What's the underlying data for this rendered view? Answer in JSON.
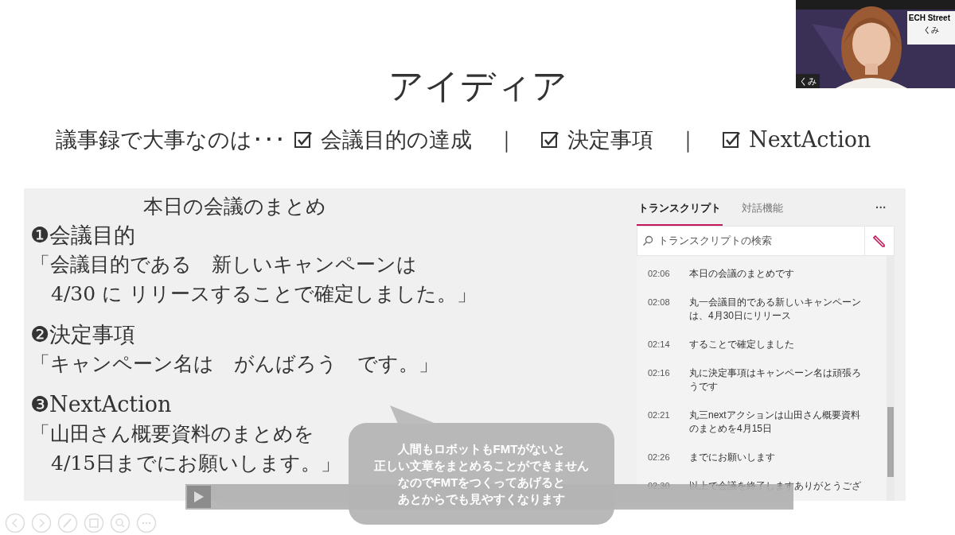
{
  "slide": {
    "title": "アイディア",
    "subtitle": {
      "lead": "議事録で大事なのは･･･",
      "separator": "｜",
      "checks": [
        {
          "label": "会議目的の達成",
          "checked": true
        },
        {
          "label": "決定事項",
          "checked": true
        },
        {
          "label": "NextAction",
          "checked": true
        }
      ]
    }
  },
  "summary": {
    "heading": "本日の会議のまとめ",
    "sections": [
      {
        "number": "❶",
        "title": "会議目的",
        "lines": [
          "「会議目的である　新しいキャンペーンは",
          "4/30 に リリースすることで確定しました。」"
        ]
      },
      {
        "number": "❷",
        "title": "決定事項",
        "lines": [
          "「キャンペーン名は　がんばろう　です。」"
        ]
      },
      {
        "number": "❸",
        "title": "NextAction",
        "lines": [
          "「山田さん概要資料のまとめを",
          "4/15日までにお願いします。」"
        ]
      }
    ]
  },
  "transcript_pane": {
    "tabs": [
      {
        "label": "トランスクリプト",
        "selected": true
      },
      {
        "label": "対話機能",
        "selected": false
      }
    ],
    "more": "···",
    "search": {
      "placeholder": "トランスクリプトの検索"
    },
    "entries": [
      {
        "time": "02:06",
        "text": "本日の会議のまとめです"
      },
      {
        "time": "02:08",
        "text": "丸一会議目的である新しいキャンペーンは、4月30日にリリース"
      },
      {
        "time": "02:14",
        "text": "することで確定しました"
      },
      {
        "time": "02:16",
        "text": "丸に決定事項はキャンペーン名は頑張ろうです"
      },
      {
        "time": "02:21",
        "text": "丸三nextアクションは山田さん概要資料のまとめを4月15日"
      },
      {
        "time": "02:26",
        "text": "までにお願いします"
      },
      {
        "time": "02:30",
        "text": "以上で会議を終了しますありがとうござ"
      }
    ]
  },
  "caption": {
    "lines": [
      "人間もロボットもFMTがないと",
      "正しい文章をまとめることができません",
      "なのでFMTをつくってあげると",
      "あとからでも見やすくなります"
    ]
  },
  "webcam": {
    "kind": "picture",
    "banner": "ECH Street",
    "subname": "くみ",
    "name_tag": "くみ"
  }
}
